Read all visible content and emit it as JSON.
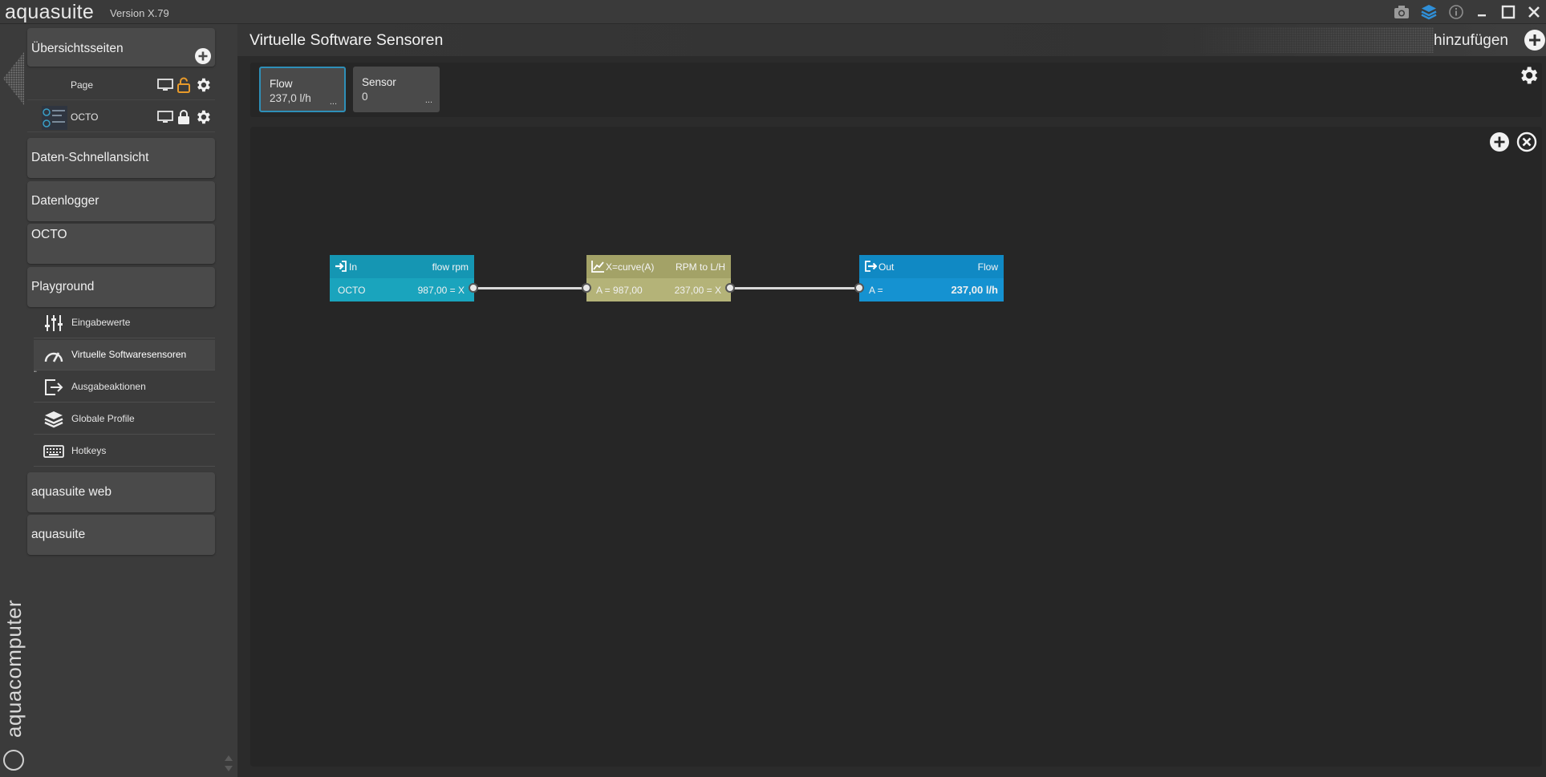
{
  "titlebar": {
    "app_name": "aquasuite",
    "version": "Version X.79"
  },
  "sidebar": {
    "overview_label": "Übersichtsseiten",
    "pages": [
      {
        "label": "Page"
      },
      {
        "label": "OCTO"
      }
    ],
    "sections": [
      {
        "label": "Daten-Schnellansicht"
      },
      {
        "label": "Datenlogger"
      },
      {
        "label": "OCTO"
      },
      {
        "label": "Playground"
      }
    ],
    "playground_items": [
      {
        "label": "Eingabewerte",
        "icon": "sliders-icon"
      },
      {
        "label": "Virtuelle Softwaresensoren",
        "icon": "gauge-icon"
      },
      {
        "label": "Ausgabeaktionen",
        "icon": "output-icon"
      },
      {
        "label": "Globale Profile",
        "icon": "layers-icon"
      },
      {
        "label": "Hotkeys",
        "icon": "keyboard-icon"
      }
    ],
    "bottom_sections": [
      {
        "label": "aquasuite web"
      },
      {
        "label": "aquasuite"
      }
    ],
    "brand_vertical": "aquacomputer"
  },
  "header": {
    "title": "Virtuelle Software Sensoren",
    "add_label": "hinzufügen"
  },
  "sensors": [
    {
      "name": "Flow",
      "value": "237,0 l/h",
      "more": "...",
      "selected": true
    },
    {
      "name": "Sensor",
      "value": "0",
      "more": "..."
    }
  ],
  "nodes": {
    "input": {
      "title": "In",
      "name": "flow rpm",
      "source": "OCTO",
      "value": "987,00 = X",
      "color": "#1596b3"
    },
    "curve": {
      "title": "X=curve(A)",
      "name": "RPM to L/H",
      "input": "A = 987,00",
      "output": "237,00 = X",
      "color": "#a6a56a"
    },
    "output": {
      "title": "Out",
      "name": "Flow",
      "input": "A =",
      "value": "237,00 l/h",
      "color": "#1089c4"
    }
  },
  "colors": {
    "accent": "#2e8fb8",
    "lock_orange": "#e89a2a",
    "layers_blue": "#2f8fd8"
  }
}
